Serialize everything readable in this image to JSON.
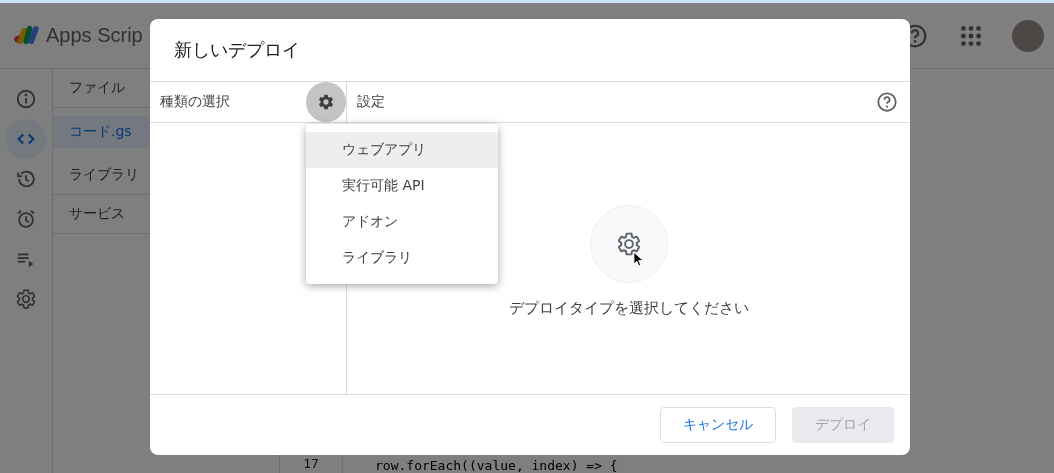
{
  "app": {
    "title": "Apps Scrip",
    "rail": [
      {
        "kind": "info",
        "selected": false
      },
      {
        "kind": "code",
        "selected": true
      },
      {
        "kind": "history",
        "selected": false
      },
      {
        "kind": "alarm",
        "selected": false
      },
      {
        "kind": "executions",
        "selected": false
      },
      {
        "kind": "settings",
        "selected": false
      }
    ],
    "files_header": "ファイル",
    "files": [
      {
        "label": "コード.gs",
        "selected": true
      },
      {
        "label": "ライブラリ",
        "selected": false
      },
      {
        "label": "サービス",
        "selected": false
      }
    ],
    "editor": {
      "line_number": "17",
      "code": "row.forEach((value, index) => {"
    }
  },
  "dialog": {
    "title": "新しいデプロイ",
    "type_pane": {
      "title": "種類の選択",
      "menu_open": true
    },
    "settings_pane": {
      "title": "設定"
    },
    "type_menu": [
      {
        "label": "ウェブアプリ",
        "selected": true
      },
      {
        "label": "実行可能 API",
        "selected": false
      },
      {
        "label": "アドオン",
        "selected": false
      },
      {
        "label": "ライブラリ",
        "selected": false
      }
    ],
    "empty_text": "デプロイタイプを選択してください",
    "buttons": [
      {
        "label": "キャンセル",
        "kind": "secondary",
        "disabled": false
      },
      {
        "label": "デプロイ",
        "kind": "primary",
        "disabled": true
      }
    ]
  }
}
